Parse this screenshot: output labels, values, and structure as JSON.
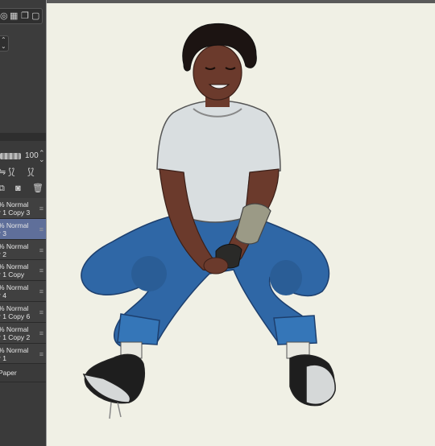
{
  "panel": {
    "opacity_value": "100",
    "layers": [
      {
        "blend": "% Normal",
        "name": "r 1 Copy 3",
        "selected": false
      },
      {
        "blend": "% Normal",
        "name": "r 3",
        "selected": true
      },
      {
        "blend": "% Normal",
        "name": "r 2",
        "selected": false
      },
      {
        "blend": "% Normal",
        "name": "r 1 Copy",
        "selected": false
      },
      {
        "blend": "% Normal",
        "name": "r 4",
        "selected": false
      },
      {
        "blend": "% Normal",
        "name": "r 1 Copy 6",
        "selected": false
      },
      {
        "blend": "% Normal",
        "name": "r 1 Copy 2",
        "selected": false
      },
      {
        "blend": "% Normal",
        "name": "r 1",
        "selected": false
      }
    ],
    "paper_label": "Paper"
  },
  "colors": {
    "canvas_bg": "#f0f0e5",
    "panel_bg": "#3a3a3a",
    "selected_layer": "#5f6f9a",
    "skin": "#6b3a2c",
    "hair": "#1c1412",
    "shirt": "#d9dee0",
    "jeans": "#2f67a6",
    "sleeve_wrap": "#9b9a86"
  },
  "icons": [
    "lock-icon",
    "checker-icon",
    "stack-icon",
    "stepper-icon",
    "mask-icon",
    "trash-icon",
    "new-layer-icon",
    "grip-icon"
  ]
}
